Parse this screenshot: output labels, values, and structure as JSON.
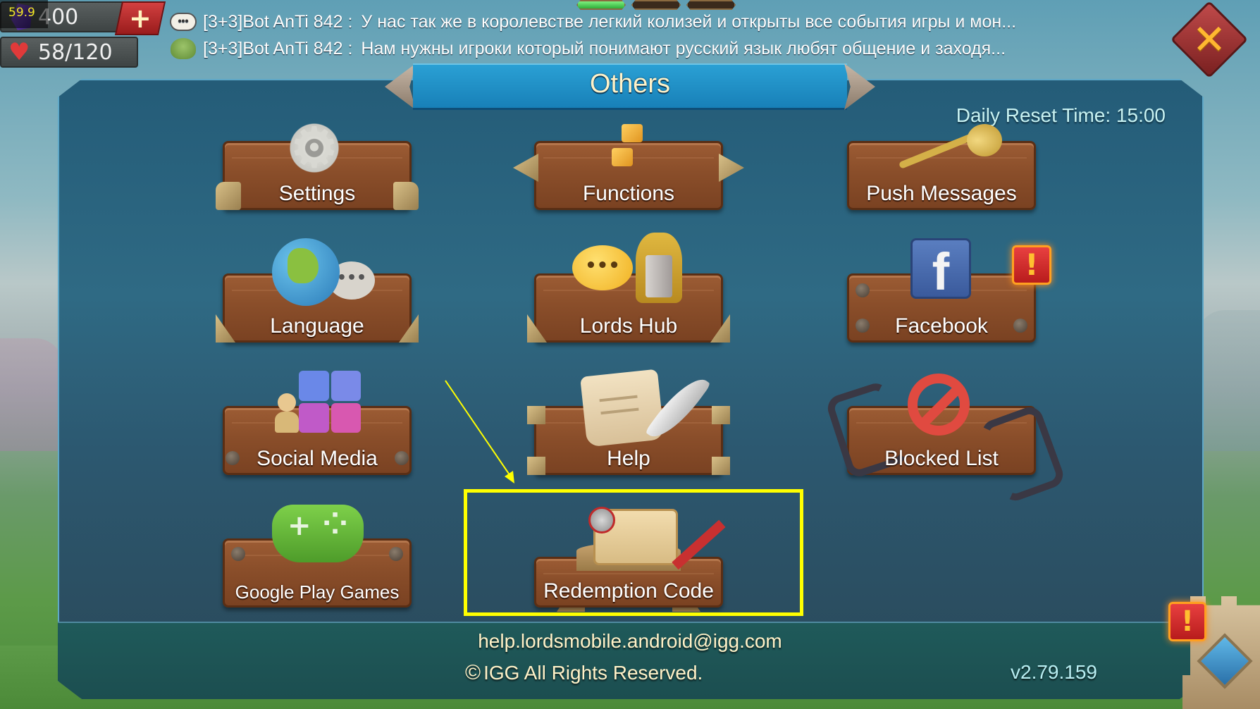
{
  "hud": {
    "fps": "59.9",
    "gems": "400",
    "stamina": "58/120",
    "add_button_label": "+"
  },
  "chat": {
    "messages": [
      {
        "sender": "[3+3]Bot AnTi 842 :",
        "text": "У нас так же в королевстве легкий колизей и открыты все события игры и мон..."
      },
      {
        "sender": "[3+3]Bot AnTi 842 :",
        "text": "Нам нужны игроки который понимают русский язык любят общение и заходя..."
      }
    ]
  },
  "close_label": "✕",
  "panel": {
    "title": "Others",
    "daily_reset": "Daily Reset Time: 15:00",
    "buttons": [
      {
        "id": "settings",
        "label": "Settings"
      },
      {
        "id": "functions",
        "label": "Functions"
      },
      {
        "id": "push-messages",
        "label": "Push Messages"
      },
      {
        "id": "language",
        "label": "Language"
      },
      {
        "id": "lords-hub",
        "label": "Lords Hub"
      },
      {
        "id": "facebook",
        "label": "Facebook",
        "alert": "!"
      },
      {
        "id": "social-media",
        "label": "Social Media"
      },
      {
        "id": "help",
        "label": "Help"
      },
      {
        "id": "blocked-list",
        "label": "Blocked List"
      },
      {
        "id": "google-play-games",
        "label": "Google Play Games"
      },
      {
        "id": "redemption-code",
        "label": "Redemption Code",
        "highlighted": true
      }
    ],
    "icon_glyphs": {
      "facebook": "f",
      "lords_hub_speech": "•••",
      "language_speech": "•••",
      "google_play": "+"
    }
  },
  "footer": {
    "email": "help.lordsmobile.android@igg.com",
    "copyright_symbol": "©",
    "copyright": "IGG All Rights Reserved.",
    "version": "v2.79.159"
  },
  "castle_alert": "!",
  "colors": {
    "highlight": "#ffff00",
    "title_banner": "#1f8fc6",
    "panel_bg": "#2a6480",
    "plank": "#8a4e2a"
  }
}
